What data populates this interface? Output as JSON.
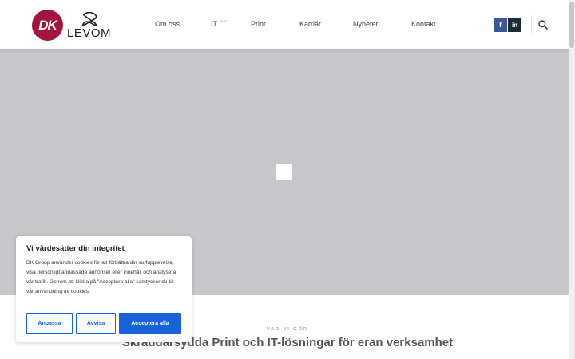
{
  "brand": {
    "dk_mark": "DK",
    "levom_name": "LEVOM"
  },
  "nav": {
    "items": [
      {
        "label": "Om oss"
      },
      {
        "label": "IT",
        "dropdown": true
      },
      {
        "label": "Print"
      },
      {
        "label": "Karriär"
      },
      {
        "label": "Nyheter"
      },
      {
        "label": "Kontakt"
      }
    ],
    "chevron_icon": "chevron-down-icon"
  },
  "social": {
    "facebook": "f",
    "linkedin": "in"
  },
  "colors": {
    "brand_red": "#a3143e",
    "facebook_blue": "#3b5998",
    "linkedin_dark": "#1e2a3a",
    "accent_blue": "#1863dc",
    "hero_gray": "#c8c8cc"
  },
  "section": {
    "kicker": "VAD VI GÖR",
    "headline": "Skräddarsydda Print och IT-lösningar för eran verksamhet"
  },
  "cookie": {
    "title": "Vi värdesätter din integritet",
    "text": "DK Group använder cookies för att förbättra din surfupplevelse, visa personligt anpassade annonser eller innehåll och analysera vår trafik. Genom att klicka på \"Acceptera alla\" samtycker du till vår användning av cookies.",
    "customize_label": "Anpassa",
    "reject_label": "Avvisa",
    "accept_label": "Acceptera alla"
  }
}
